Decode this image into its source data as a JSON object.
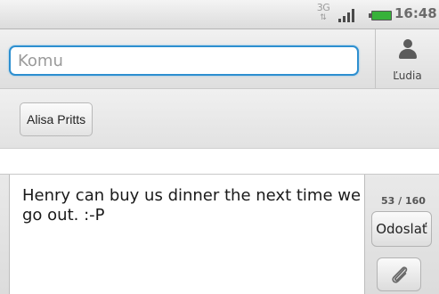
{
  "status_bar": {
    "network_type": "3G",
    "time": "16:48",
    "battery_color": "#37b23a"
  },
  "recipient": {
    "placeholder": "Komu",
    "people_button_label": "Ľudia"
  },
  "recipient_chip": "Alisa Pritts",
  "message": {
    "text": "Henry can buy us dinner the next time we go out.  :-P",
    "counter": "53 / 160",
    "send_label": "Odoslať"
  },
  "icons": [
    "network-3g-icon",
    "signal-icon",
    "battery-icon",
    "person-icon",
    "paperclip-icon"
  ],
  "colors": {
    "focus_border": "#2d8fd0"
  }
}
